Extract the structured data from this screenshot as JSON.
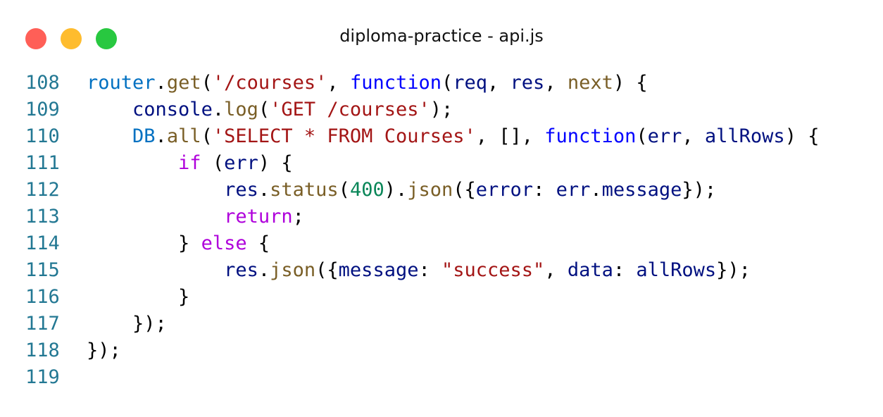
{
  "window": {
    "title": "diploma-practice - api.js",
    "buttons": [
      {
        "name": "close",
        "color": "#ff5f57"
      },
      {
        "name": "minimize",
        "color": "#febc2e"
      },
      {
        "name": "maximize",
        "color": "#28c840"
      }
    ]
  },
  "colors": {
    "line_number": "#237893",
    "plain": "#000000",
    "variable": "#001080",
    "object": "#0070c1",
    "function_call": "#795e26",
    "string": "#a31515",
    "keyword": "#0000ff",
    "control": "#af00db",
    "number": "#098658"
  },
  "code": {
    "lines": [
      {
        "number": "108",
        "indent": 0,
        "tokens": [
          {
            "t": "router",
            "c": "object"
          },
          {
            "t": ".",
            "c": "plain"
          },
          {
            "t": "get",
            "c": "function_call"
          },
          {
            "t": "(",
            "c": "plain"
          },
          {
            "t": "'/courses'",
            "c": "string"
          },
          {
            "t": ", ",
            "c": "plain"
          },
          {
            "t": "function",
            "c": "keyword"
          },
          {
            "t": "(",
            "c": "plain"
          },
          {
            "t": "req",
            "c": "variable"
          },
          {
            "t": ", ",
            "c": "plain"
          },
          {
            "t": "res",
            "c": "variable"
          },
          {
            "t": ", ",
            "c": "plain"
          },
          {
            "t": "next",
            "c": "function_call"
          },
          {
            "t": ") {",
            "c": "plain"
          }
        ]
      },
      {
        "number": "109",
        "indent": 4,
        "tokens": [
          {
            "t": "console",
            "c": "variable"
          },
          {
            "t": ".",
            "c": "plain"
          },
          {
            "t": "log",
            "c": "function_call"
          },
          {
            "t": "(",
            "c": "plain"
          },
          {
            "t": "'GET /courses'",
            "c": "string"
          },
          {
            "t": ");",
            "c": "plain"
          }
        ]
      },
      {
        "number": "110",
        "indent": 4,
        "tokens": [
          {
            "t": "DB",
            "c": "object"
          },
          {
            "t": ".",
            "c": "plain"
          },
          {
            "t": "all",
            "c": "function_call"
          },
          {
            "t": "(",
            "c": "plain"
          },
          {
            "t": "'SELECT * FROM Courses'",
            "c": "string"
          },
          {
            "t": ", [], ",
            "c": "plain"
          },
          {
            "t": "function",
            "c": "keyword"
          },
          {
            "t": "(",
            "c": "plain"
          },
          {
            "t": "err",
            "c": "variable"
          },
          {
            "t": ", ",
            "c": "plain"
          },
          {
            "t": "allRows",
            "c": "variable"
          },
          {
            "t": ") {",
            "c": "plain"
          }
        ]
      },
      {
        "number": "111",
        "indent": 8,
        "tokens": [
          {
            "t": "if",
            "c": "control"
          },
          {
            "t": " (",
            "c": "plain"
          },
          {
            "t": "err",
            "c": "variable"
          },
          {
            "t": ") {",
            "c": "plain"
          }
        ]
      },
      {
        "number": "112",
        "indent": 12,
        "tokens": [
          {
            "t": "res",
            "c": "variable"
          },
          {
            "t": ".",
            "c": "plain"
          },
          {
            "t": "status",
            "c": "function_call"
          },
          {
            "t": "(",
            "c": "plain"
          },
          {
            "t": "400",
            "c": "number"
          },
          {
            "t": ").",
            "c": "plain"
          },
          {
            "t": "json",
            "c": "function_call"
          },
          {
            "t": "({",
            "c": "plain"
          },
          {
            "t": "error",
            "c": "variable"
          },
          {
            "t": ": ",
            "c": "plain"
          },
          {
            "t": "err",
            "c": "variable"
          },
          {
            "t": ".",
            "c": "plain"
          },
          {
            "t": "message",
            "c": "variable"
          },
          {
            "t": "});",
            "c": "plain"
          }
        ]
      },
      {
        "number": "113",
        "indent": 12,
        "tokens": [
          {
            "t": "return",
            "c": "control"
          },
          {
            "t": ";",
            "c": "plain"
          }
        ]
      },
      {
        "number": "114",
        "indent": 8,
        "tokens": [
          {
            "t": "} ",
            "c": "plain"
          },
          {
            "t": "else",
            "c": "control"
          },
          {
            "t": " {",
            "c": "plain"
          }
        ]
      },
      {
        "number": "115",
        "indent": 12,
        "tokens": [
          {
            "t": "res",
            "c": "variable"
          },
          {
            "t": ".",
            "c": "plain"
          },
          {
            "t": "json",
            "c": "function_call"
          },
          {
            "t": "({",
            "c": "plain"
          },
          {
            "t": "message",
            "c": "variable"
          },
          {
            "t": ": ",
            "c": "plain"
          },
          {
            "t": "\"success\"",
            "c": "string"
          },
          {
            "t": ", ",
            "c": "plain"
          },
          {
            "t": "data",
            "c": "variable"
          },
          {
            "t": ": ",
            "c": "plain"
          },
          {
            "t": "allRows",
            "c": "variable"
          },
          {
            "t": "});",
            "c": "plain"
          }
        ]
      },
      {
        "number": "116",
        "indent": 8,
        "tokens": [
          {
            "t": "}",
            "c": "plain"
          }
        ]
      },
      {
        "number": "117",
        "indent": 4,
        "tokens": [
          {
            "t": "});",
            "c": "plain"
          }
        ]
      },
      {
        "number": "118",
        "indent": 0,
        "tokens": [
          {
            "t": "});",
            "c": "plain"
          }
        ]
      },
      {
        "number": "119",
        "indent": 0,
        "tokens": []
      }
    ]
  }
}
